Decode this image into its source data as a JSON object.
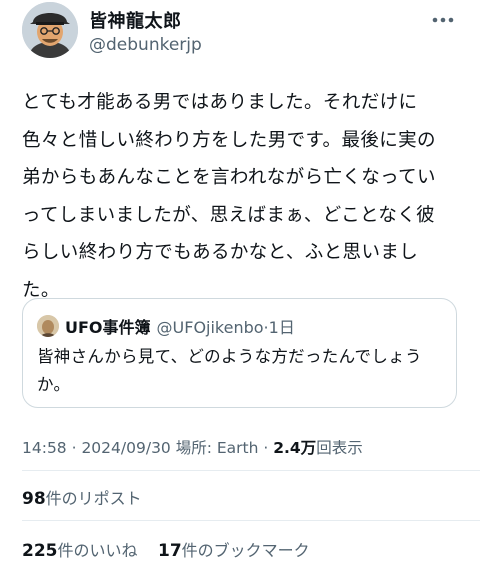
{
  "tweet": {
    "author": {
      "display_name": "皆神龍太郎",
      "handle": "@debunkerjp",
      "avatar_icon": "avatar-illustration"
    },
    "more_icon": "more-options-icon",
    "body": "とても才能ある男ではありました。それだけに\n色々と惜しい終わり方をした男です。最後に実の\n弟からもあんなことを言われながら亡くなってい\nってしまいましたが、思えばまぁ、どことなく彼\nらしい終わり方でもあるかなと、ふと思いまし\nた。",
    "quoted": {
      "display_name": "UFO事件簿",
      "handle_time": "@UFOjikenbo·1日",
      "text": "皆神さんから見て、どのような方だったんでしょう\nか。"
    },
    "meta": {
      "time": "14:58 · 2024/09/30 ",
      "location_label": "場所: Earth · ",
      "views_count": "2.4万",
      "views_label": "回表示"
    },
    "stats": {
      "reposts_count": "98",
      "reposts_label": "件のリポスト",
      "likes_count": "225",
      "likes_label": "件のいいね",
      "bookmarks_count": "17",
      "bookmarks_label": "件のブックマーク"
    }
  }
}
